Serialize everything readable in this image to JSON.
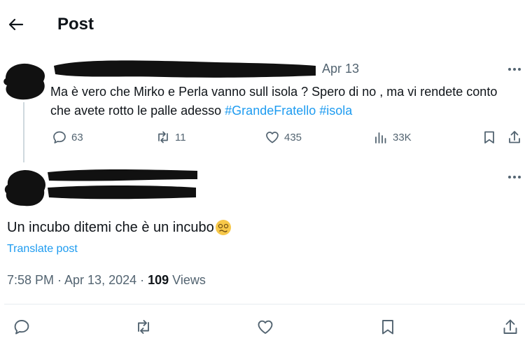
{
  "header": {
    "title": "Post",
    "back_icon": "arrow-left-icon"
  },
  "parent_post": {
    "date": "Apr 13",
    "text_parts": [
      {
        "text": "Ma è vero che Mirko e Perla vanno sull isola ? Spero di no , ma vi rendete conto che avete rotto le palle adesso ",
        "type": "plain"
      },
      {
        "text": "#GrandeFratello",
        "type": "hashtag"
      },
      {
        "text": "  ",
        "type": "plain"
      },
      {
        "text": "#isola",
        "type": "hashtag"
      }
    ],
    "stats": {
      "replies": "63",
      "reposts": "11",
      "likes": "435",
      "views": "33K"
    }
  },
  "main_post": {
    "text": "Un incubo ditemi che è un incubo",
    "emoji": "dizzy-face-emoji",
    "translate": "Translate post",
    "timestamp": "7:58 PM · Apr 13, 2024 · ",
    "views_count": "109",
    "views_label": " Views"
  },
  "colors": {
    "accent": "#1d9bf0",
    "muted": "#536471",
    "text": "#0f1419",
    "divider": "#e6ecf0"
  }
}
